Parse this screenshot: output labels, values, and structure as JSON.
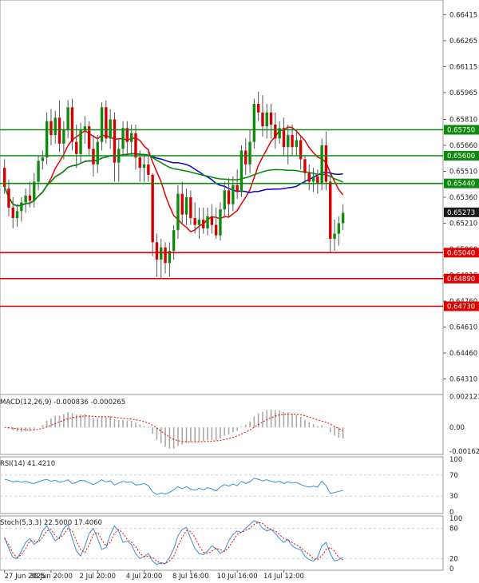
{
  "chart_data": [
    {
      "type": "candlestick",
      "price_ticks": [
        "0.66415",
        "0.66265",
        "0.66115",
        "0.65965",
        "0.65810",
        "0.65660",
        "0.65510",
        "0.65360",
        "0.65210",
        "0.65060",
        "0.64910",
        "0.64760",
        "0.64610",
        "0.64460",
        "0.64310"
      ],
      "ylim": [
        0.6422,
        0.665
      ],
      "last_price": 0.65273,
      "last_price_label": "0.65273",
      "levels": [
        {
          "value": 0.6575,
          "label": "0.65750",
          "color": "#0e8a0e"
        },
        {
          "value": 0.656,
          "label": "0.65600",
          "color": "#0e8a0e"
        },
        {
          "value": 0.6544,
          "label": "0.65440",
          "color": "#0e8a0e"
        },
        {
          "value": 0.6504,
          "label": "0.65040",
          "color": "#e10000"
        },
        {
          "value": 0.6489,
          "label": "0.64890",
          "color": "#e10000"
        },
        {
          "value": 0.6473,
          "label": "0.64730",
          "color": "#e10000"
        }
      ],
      "candles": [
        {
          "o": 0.6553,
          "h": 0.6558,
          "l": 0.6538,
          "c": 0.6542
        },
        {
          "o": 0.6541,
          "h": 0.6546,
          "l": 0.6525,
          "c": 0.653
        },
        {
          "o": 0.653,
          "h": 0.6536,
          "l": 0.6518,
          "c": 0.6524
        },
        {
          "o": 0.6524,
          "h": 0.6532,
          "l": 0.6519,
          "c": 0.6528
        },
        {
          "o": 0.6528,
          "h": 0.6536,
          "l": 0.6522,
          "c": 0.6533
        },
        {
          "o": 0.6533,
          "h": 0.6541,
          "l": 0.6527,
          "c": 0.6537
        },
        {
          "o": 0.6537,
          "h": 0.6545,
          "l": 0.653,
          "c": 0.6534
        },
        {
          "o": 0.6534,
          "h": 0.655,
          "l": 0.653,
          "c": 0.6545
        },
        {
          "o": 0.6545,
          "h": 0.656,
          "l": 0.654,
          "c": 0.6557
        },
        {
          "o": 0.6557,
          "h": 0.6563,
          "l": 0.6552,
          "c": 0.6559
        },
        {
          "o": 0.6559,
          "h": 0.6585,
          "l": 0.6555,
          "c": 0.658
        },
        {
          "o": 0.658,
          "h": 0.6587,
          "l": 0.6566,
          "c": 0.6572
        },
        {
          "o": 0.6572,
          "h": 0.6586,
          "l": 0.6567,
          "c": 0.6582
        },
        {
          "o": 0.6582,
          "h": 0.6592,
          "l": 0.6562,
          "c": 0.6567
        },
        {
          "o": 0.6567,
          "h": 0.658,
          "l": 0.6558,
          "c": 0.6575
        },
        {
          "o": 0.6575,
          "h": 0.6592,
          "l": 0.657,
          "c": 0.6588
        },
        {
          "o": 0.6588,
          "h": 0.6593,
          "l": 0.6563,
          "c": 0.6568
        },
        {
          "o": 0.6568,
          "h": 0.6578,
          "l": 0.6553,
          "c": 0.6561
        },
        {
          "o": 0.6561,
          "h": 0.6579,
          "l": 0.6556,
          "c": 0.6575
        },
        {
          "o": 0.6575,
          "h": 0.6583,
          "l": 0.6567,
          "c": 0.6577
        },
        {
          "o": 0.6577,
          "h": 0.658,
          "l": 0.656,
          "c": 0.6564
        },
        {
          "o": 0.6564,
          "h": 0.6572,
          "l": 0.6548,
          "c": 0.6555
        },
        {
          "o": 0.6555,
          "h": 0.6572,
          "l": 0.655,
          "c": 0.6568
        },
        {
          "o": 0.6568,
          "h": 0.6591,
          "l": 0.6563,
          "c": 0.6588
        },
        {
          "o": 0.6588,
          "h": 0.6592,
          "l": 0.6567,
          "c": 0.657
        },
        {
          "o": 0.657,
          "h": 0.6587,
          "l": 0.6564,
          "c": 0.6581
        },
        {
          "o": 0.6581,
          "h": 0.6585,
          "l": 0.6545,
          "c": 0.6556
        },
        {
          "o": 0.6556,
          "h": 0.657,
          "l": 0.6545,
          "c": 0.6564
        },
        {
          "o": 0.6564,
          "h": 0.658,
          "l": 0.656,
          "c": 0.6576
        },
        {
          "o": 0.6576,
          "h": 0.658,
          "l": 0.656,
          "c": 0.6568
        },
        {
          "o": 0.6568,
          "h": 0.6578,
          "l": 0.656,
          "c": 0.6573
        },
        {
          "o": 0.6573,
          "h": 0.6578,
          "l": 0.6552,
          "c": 0.6559
        },
        {
          "o": 0.6559,
          "h": 0.6563,
          "l": 0.6545,
          "c": 0.6553
        },
        {
          "o": 0.6553,
          "h": 0.656,
          "l": 0.6545,
          "c": 0.6555
        },
        {
          "o": 0.6555,
          "h": 0.6564,
          "l": 0.6545,
          "c": 0.6549
        },
        {
          "o": 0.6549,
          "h": 0.655,
          "l": 0.6502,
          "c": 0.651
        },
        {
          "o": 0.651,
          "h": 0.6515,
          "l": 0.649,
          "c": 0.65
        },
        {
          "o": 0.65,
          "h": 0.6512,
          "l": 0.6489,
          "c": 0.6507
        },
        {
          "o": 0.6507,
          "h": 0.651,
          "l": 0.6492,
          "c": 0.6498
        },
        {
          "o": 0.6498,
          "h": 0.651,
          "l": 0.649,
          "c": 0.6505
        },
        {
          "o": 0.6505,
          "h": 0.652,
          "l": 0.65,
          "c": 0.6517
        },
        {
          "o": 0.6517,
          "h": 0.6543,
          "l": 0.6512,
          "c": 0.6538
        },
        {
          "o": 0.6538,
          "h": 0.6545,
          "l": 0.652,
          "c": 0.6526
        },
        {
          "o": 0.6526,
          "h": 0.6541,
          "l": 0.652,
          "c": 0.6536
        },
        {
          "o": 0.6536,
          "h": 0.654,
          "l": 0.652,
          "c": 0.6524
        },
        {
          "o": 0.6524,
          "h": 0.6533,
          "l": 0.6515,
          "c": 0.652
        },
        {
          "o": 0.652,
          "h": 0.653,
          "l": 0.6512,
          "c": 0.6523
        },
        {
          "o": 0.6523,
          "h": 0.653,
          "l": 0.6515,
          "c": 0.6518
        },
        {
          "o": 0.6518,
          "h": 0.653,
          "l": 0.6514,
          "c": 0.6525
        },
        {
          "o": 0.6525,
          "h": 0.6532,
          "l": 0.6515,
          "c": 0.652
        },
        {
          "o": 0.652,
          "h": 0.653,
          "l": 0.6512,
          "c": 0.6514
        },
        {
          "o": 0.6514,
          "h": 0.6533,
          "l": 0.6511,
          "c": 0.6529
        },
        {
          "o": 0.6529,
          "h": 0.6545,
          "l": 0.6524,
          "c": 0.654
        },
        {
          "o": 0.654,
          "h": 0.6547,
          "l": 0.6525,
          "c": 0.6532
        },
        {
          "o": 0.6532,
          "h": 0.6548,
          "l": 0.6528,
          "c": 0.6543
        },
        {
          "o": 0.6543,
          "h": 0.6552,
          "l": 0.6535,
          "c": 0.6539
        },
        {
          "o": 0.6539,
          "h": 0.6566,
          "l": 0.6536,
          "c": 0.6563
        },
        {
          "o": 0.6563,
          "h": 0.657,
          "l": 0.6549,
          "c": 0.6555
        },
        {
          "o": 0.6555,
          "h": 0.6575,
          "l": 0.655,
          "c": 0.6568
        },
        {
          "o": 0.6568,
          "h": 0.6593,
          "l": 0.6564,
          "c": 0.659
        },
        {
          "o": 0.659,
          "h": 0.6597,
          "l": 0.658,
          "c": 0.6585
        },
        {
          "o": 0.6585,
          "h": 0.6595,
          "l": 0.6571,
          "c": 0.6577
        },
        {
          "o": 0.6577,
          "h": 0.659,
          "l": 0.657,
          "c": 0.6585
        },
        {
          "o": 0.6585,
          "h": 0.659,
          "l": 0.657,
          "c": 0.6578
        },
        {
          "o": 0.6578,
          "h": 0.6585,
          "l": 0.6564,
          "c": 0.657
        },
        {
          "o": 0.657,
          "h": 0.658,
          "l": 0.6567,
          "c": 0.6576
        },
        {
          "o": 0.6576,
          "h": 0.6582,
          "l": 0.656,
          "c": 0.6565
        },
        {
          "o": 0.6565,
          "h": 0.6578,
          "l": 0.6555,
          "c": 0.6572
        },
        {
          "o": 0.6572,
          "h": 0.6578,
          "l": 0.656,
          "c": 0.6565
        },
        {
          "o": 0.6565,
          "h": 0.6574,
          "l": 0.656,
          "c": 0.6569
        },
        {
          "o": 0.6569,
          "h": 0.6572,
          "l": 0.6552,
          "c": 0.6558
        },
        {
          "o": 0.6558,
          "h": 0.656,
          "l": 0.6544,
          "c": 0.655
        },
        {
          "o": 0.655,
          "h": 0.6555,
          "l": 0.654,
          "c": 0.6545
        },
        {
          "o": 0.6545,
          "h": 0.6553,
          "l": 0.6539,
          "c": 0.6548
        },
        {
          "o": 0.6548,
          "h": 0.6552,
          "l": 0.6538,
          "c": 0.6544
        },
        {
          "o": 0.6544,
          "h": 0.657,
          "l": 0.654,
          "c": 0.6566
        },
        {
          "o": 0.6566,
          "h": 0.6574,
          "l": 0.654,
          "c": 0.6545
        },
        {
          "o": 0.6545,
          "h": 0.655,
          "l": 0.6504,
          "c": 0.6512
        },
        {
          "o": 0.6512,
          "h": 0.6523,
          "l": 0.6505,
          "c": 0.6515
        },
        {
          "o": 0.6515,
          "h": 0.6525,
          "l": 0.6508,
          "c": 0.6521
        },
        {
          "o": 0.6521,
          "h": 0.6532,
          "l": 0.6517,
          "c": 0.6527
        }
      ],
      "time_labels": [
        "27 Jun 2025",
        "30 Jun 20:00",
        "2 Jul 20:00",
        "4 Jul 20:00",
        "8 Jul 16:00",
        "10 Jul 16:00",
        "14 Jul 12:00"
      ],
      "time_label_candles": [
        0,
        11,
        22,
        33,
        44,
        55,
        66
      ],
      "moving_averages": [
        {
          "color": "#e60000",
          "period": 10
        },
        {
          "color": "#0000d0",
          "period": 35
        },
        {
          "color": "#008a00",
          "period": 55
        }
      ]
    },
    {
      "type": "bar",
      "indicator": "MACD",
      "label": "MACD(12,26,9) -0.000836 -0.000265",
      "tick_labels": [
        "0.002123",
        "0.00",
        "-0.001627"
      ],
      "tick_values": [
        0.002123,
        0,
        -0.001627
      ],
      "ylim": [
        -0.00185,
        0.00225
      ],
      "histogram_color": "#a8a8a8",
      "signal_color": "#e60000"
    },
    {
      "type": "line",
      "indicator": "RSI",
      "label": "RSI(14) 41.4210",
      "tick_labels": [
        "100",
        "70",
        "30",
        "0"
      ],
      "tick_values": [
        100,
        70,
        30,
        0
      ],
      "ylim": [
        0,
        100
      ],
      "color": "#3a8fd8",
      "values": [
        62,
        60,
        57,
        59,
        56,
        58,
        55,
        54,
        57,
        60,
        62,
        58,
        60,
        56,
        58,
        61,
        54,
        56,
        60,
        59,
        55,
        52,
        56,
        61,
        57,
        59,
        51,
        55,
        58,
        56,
        57,
        51,
        52,
        54,
        50,
        38,
        33,
        36,
        34,
        37,
        42,
        48,
        44,
        48,
        43,
        41,
        45,
        42,
        46,
        44,
        40,
        47,
        52,
        49,
        53,
        50,
        58,
        54,
        57,
        64,
        62,
        59,
        61,
        58,
        56,
        58,
        54,
        57,
        55,
        56,
        52,
        49,
        47,
        49,
        47,
        58,
        50,
        35,
        37,
        39,
        41
      ]
    },
    {
      "type": "line",
      "indicator": "Stochastic",
      "label": "Stoch(5,3,3) 22.5000 17.4060",
      "tick_labels": [
        "100",
        "80",
        "20",
        "0"
      ],
      "tick_values": [
        100,
        80,
        20,
        0
      ],
      "ylim": [
        0,
        100
      ],
      "main_color": "#3a8fd8",
      "signal_color": "#e60000",
      "k_values": [
        62,
        40,
        22,
        20,
        35,
        52,
        60,
        48,
        55,
        75,
        85,
        70,
        55,
        62,
        80,
        88,
        60,
        35,
        25,
        45,
        70,
        80,
        60,
        38,
        42,
        68,
        85,
        74,
        52,
        55,
        48,
        30,
        20,
        24,
        30,
        15,
        8,
        12,
        10,
        22,
        40,
        65,
        78,
        82,
        60,
        40,
        30,
        28,
        35,
        45,
        40,
        30,
        36,
        55,
        68,
        75,
        72,
        80,
        88,
        95,
        92,
        80,
        75,
        78,
        70,
        60,
        52,
        58,
        45,
        40,
        38,
        25,
        18,
        15,
        22,
        45,
        52,
        30,
        15,
        18,
        22
      ],
      "d_values": [
        60,
        48,
        30,
        22,
        28,
        40,
        55,
        55,
        53,
        62,
        75,
        78,
        65,
        60,
        68,
        80,
        75,
        55,
        38,
        32,
        48,
        68,
        72,
        58,
        45,
        52,
        70,
        78,
        70,
        58,
        52,
        44,
        30,
        24,
        25,
        22,
        15,
        10,
        10,
        15,
        25,
        45,
        62,
        76,
        74,
        62,
        45,
        33,
        30,
        35,
        40,
        38,
        34,
        42,
        55,
        68,
        72,
        76,
        80,
        88,
        92,
        90,
        82,
        78,
        75,
        68,
        60,
        57,
        52,
        47,
        42,
        35,
        28,
        20,
        18,
        25,
        38,
        42,
        35,
        22,
        17
      ]
    }
  ]
}
